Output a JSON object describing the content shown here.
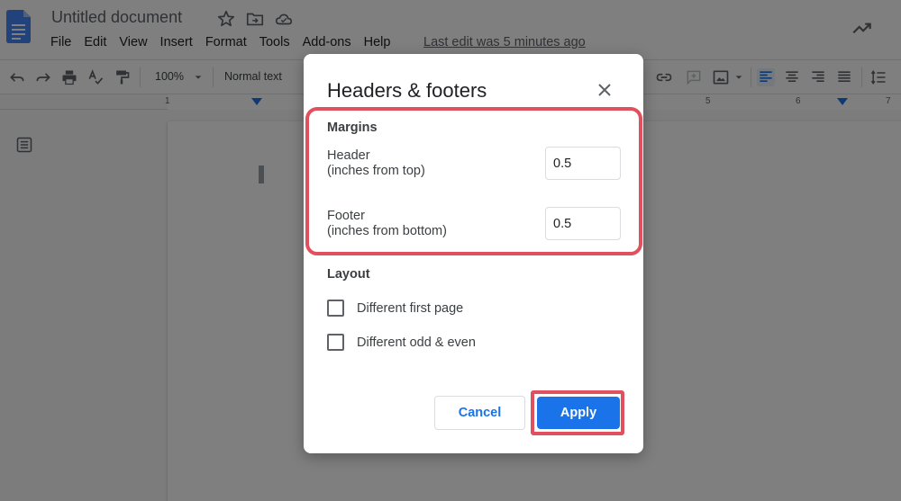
{
  "app": {
    "title": "Untitled document",
    "last_edit": "Last edit was 5 minutes ago"
  },
  "menu": [
    "File",
    "Edit",
    "View",
    "Insert",
    "Format",
    "Tools",
    "Add-ons",
    "Help"
  ],
  "toolbar": {
    "zoom": "100%",
    "style": "Normal text"
  },
  "ruler": {
    "numbers": [
      "1",
      "5",
      "6",
      "7"
    ]
  },
  "dialog": {
    "title": "Headers & footers",
    "margins_title": "Margins",
    "header_label_line1": "Header",
    "header_label_line2": "(inches from top)",
    "header_value": "0.5",
    "footer_label_line1": "Footer",
    "footer_label_line2": "(inches from bottom)",
    "footer_value": "0.5",
    "layout_title": "Layout",
    "different_first_page": "Different first page",
    "different_odd_even": "Different odd & even",
    "cancel_label": "Cancel",
    "apply_label": "Apply"
  },
  "colors": {
    "accent": "#1a73e8",
    "highlight": "#e0505e",
    "doc_icon": "#4285f4"
  },
  "icons": [
    "docs-logo-icon",
    "star-icon",
    "folder-move-icon",
    "cloud-icon",
    "trending-icon",
    "undo-icon",
    "redo-icon",
    "print-icon",
    "spellcheck-icon",
    "paint-format-icon",
    "link-icon",
    "comment-add-icon",
    "image-icon",
    "align-left-icon",
    "align-center-icon",
    "align-right-icon",
    "justify-icon",
    "line-spacing-icon",
    "outline-icon",
    "close-icon"
  ]
}
